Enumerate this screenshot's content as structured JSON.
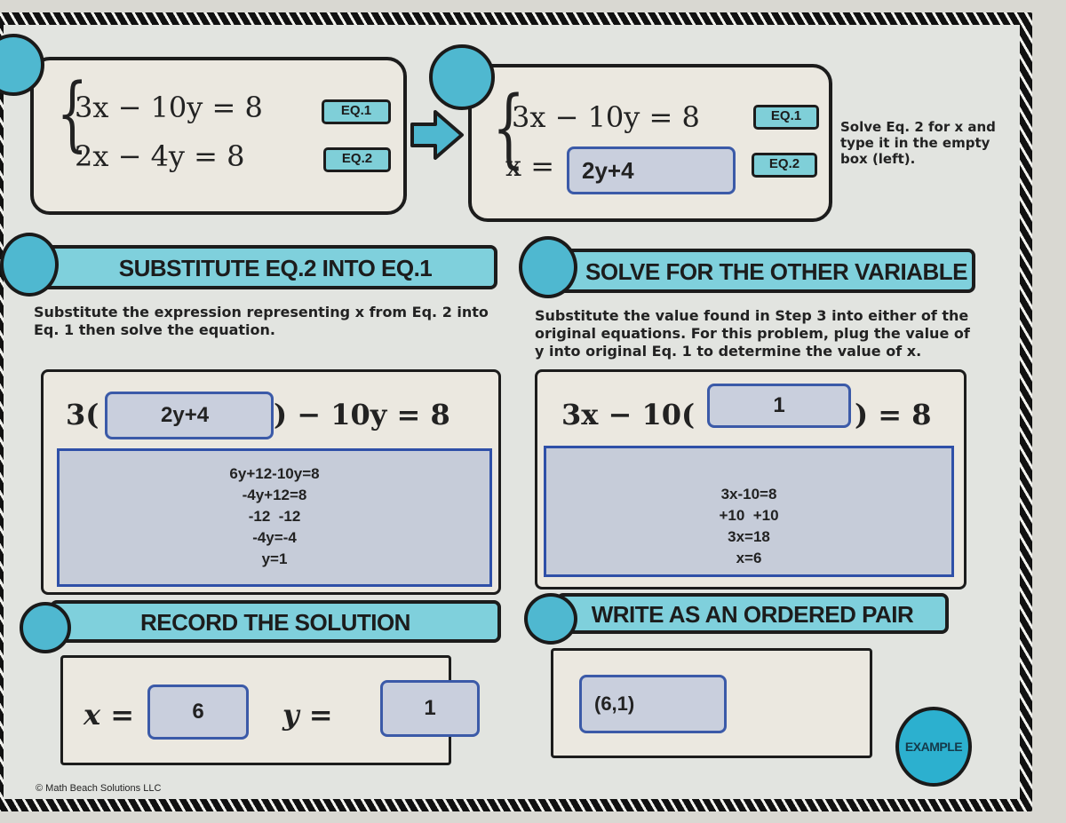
{
  "step1": {
    "eq1": "3x − 10y = 8",
    "eq2": "2x − 4y = 8",
    "eq1_tag": "EQ.1",
    "eq2_tag": "EQ.2"
  },
  "step2": {
    "eq1": "3x − 10y = 8",
    "eq2_prefix": "x =",
    "eq2_input_value": "2y+4",
    "eq1_tag": "EQ.1",
    "eq2_tag": "EQ.2",
    "instruction": "Solve Eq. 2 for x and type it in the empty box (left)."
  },
  "step3": {
    "title": "SUBSTITUTE EQ.2 INTO EQ.1",
    "description": "Substitute the expression representing x from Eq. 2 into Eq. 1 then solve the equation.",
    "equation_prefix": "3(",
    "equation_input_value": "2y+4",
    "equation_suffix": ") − 10y = 8",
    "work_lines": [
      "6y+12-10y=8",
      "-4y+12=8",
      "-12  -12",
      "-4y=-4",
      "y=1"
    ]
  },
  "step4": {
    "title": "SOLVE FOR THE OTHER VARIABLE",
    "description": "Substitute the value found in Step 3 into either of the original equations. For this problem, plug the value of y into original Eq. 1 to determine the value of x.",
    "equation_prefix": "3x − 10(",
    "equation_input_value": "1",
    "equation_suffix": ") = 8",
    "work_lines": [
      "3x-10=8",
      "+10  +10",
      "3x=18",
      "x=6"
    ]
  },
  "step5": {
    "title": "RECORD THE SOLUTION",
    "x_label": "x =",
    "x_value": "6",
    "y_label": "y =",
    "y_value": "1"
  },
  "step6": {
    "title": "WRITE AS AN ORDERED PAIR",
    "ordered_pair_value": "(6,1)"
  },
  "badge": "EXAMPLE",
  "copyright": "© Math Beach Solutions LLC",
  "colors": {
    "accent": "#4fb8d0",
    "banner": "#7fd0dc",
    "input_fill": "#c9cfdd",
    "input_border": "#3b5aa8"
  }
}
